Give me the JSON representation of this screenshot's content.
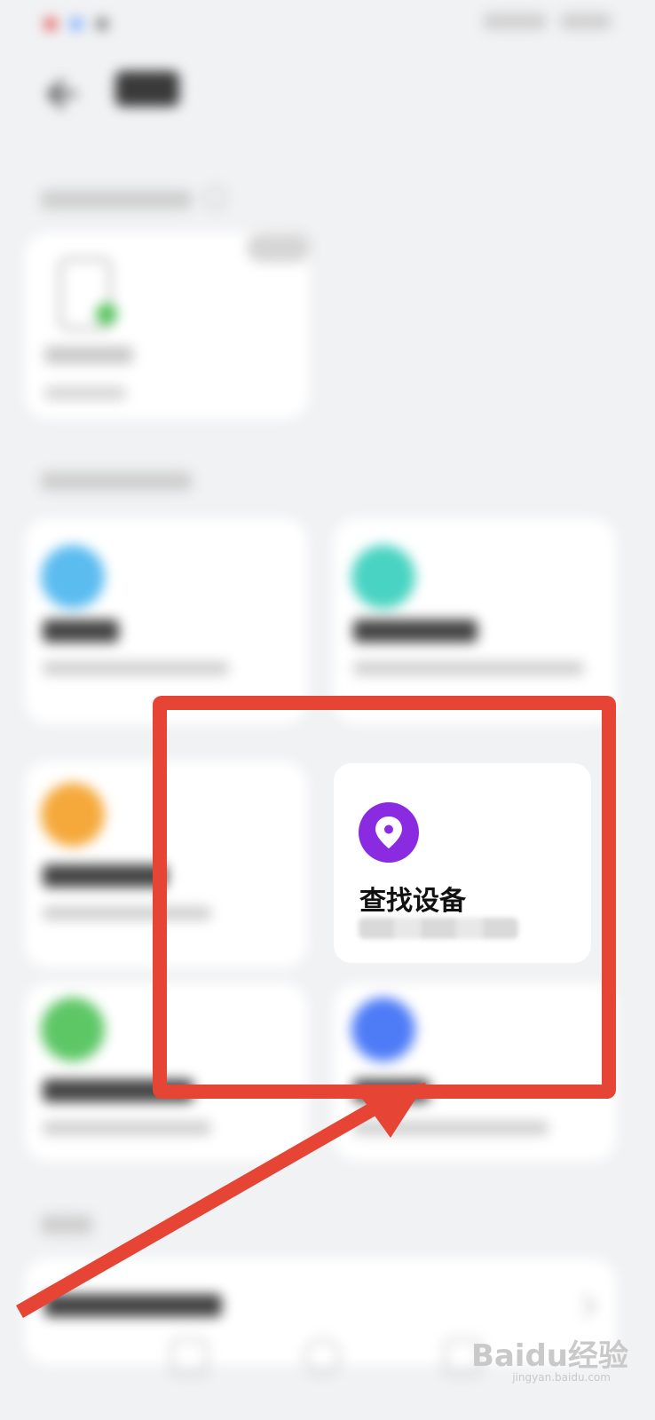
{
  "status_bar": {
    "left_text": "",
    "right_text": ""
  },
  "header": {
    "title": ""
  },
  "sections": {
    "linked_devices": "",
    "safety_features": "",
    "more": ""
  },
  "device_card": {
    "name": "",
    "status": ""
  },
  "feature_cards": [
    {
      "title": "",
      "subtitle": "",
      "color": "#5bbcf0"
    },
    {
      "title": "",
      "subtitle": "",
      "color": "#49d3c2"
    },
    {
      "title": "",
      "subtitle": "",
      "color": "#f5a93b"
    },
    {
      "title": "查找设备",
      "subtitle": "",
      "color": "#8a2be2"
    },
    {
      "title": "",
      "subtitle": "",
      "color": "#5dc766"
    },
    {
      "title": "",
      "subtitle": "",
      "color": "#4e7cf7"
    }
  ],
  "bottom_item": {
    "label": ""
  },
  "annotation": {
    "box_color": "#e64435",
    "arrow_color": "#e64435"
  },
  "watermark": {
    "brand": "Baidu经验",
    "url": "jingyan.baidu.com"
  }
}
